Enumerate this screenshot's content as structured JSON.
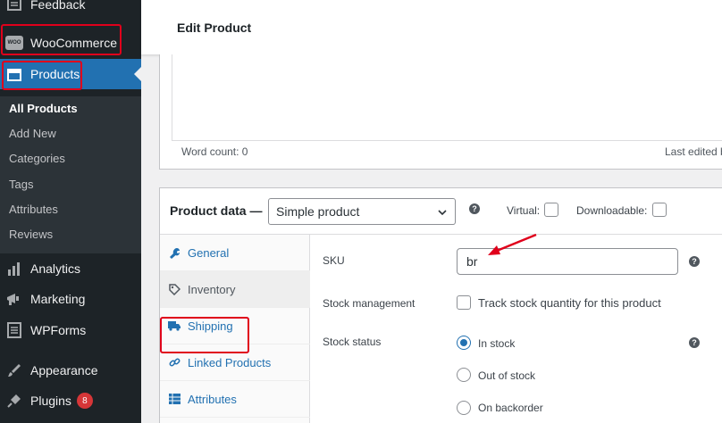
{
  "sidebar": {
    "items": [
      {
        "label": "Feedback",
        "icon": "feedback-icon"
      },
      {
        "label": "WooCommerce",
        "icon": "woocommerce-icon"
      },
      {
        "label": "Products",
        "icon": "products-icon"
      },
      {
        "label": "Analytics",
        "icon": "analytics-icon"
      },
      {
        "label": "Marketing",
        "icon": "marketing-icon"
      },
      {
        "label": "WPForms",
        "icon": "wpforms-icon"
      },
      {
        "label": "Appearance",
        "icon": "appearance-icon"
      },
      {
        "label": "Plugins",
        "icon": "plugins-icon",
        "badge": "8"
      }
    ],
    "submenu": [
      "All Products",
      "Add New",
      "Categories",
      "Tags",
      "Attributes",
      "Reviews"
    ],
    "woo_logo_text": "WOO"
  },
  "header": {
    "title": "Edit Product"
  },
  "editor": {
    "word_count": "Word count: 0",
    "last_edited": "Last edited b"
  },
  "product_data": {
    "title": "Product data —",
    "type_selected": "Simple product",
    "virtual_label": "Virtual:",
    "downloadable_label": "Downloadable:",
    "tabs": [
      {
        "label": "General",
        "icon": "wrench-icon"
      },
      {
        "label": "Inventory",
        "icon": "tag-icon"
      },
      {
        "label": "Shipping",
        "icon": "truck-icon"
      },
      {
        "label": "Linked Products",
        "icon": "link-icon"
      },
      {
        "label": "Attributes",
        "icon": "table-icon"
      }
    ],
    "sku_label": "SKU",
    "sku_value": "br",
    "stock_management_label": "Stock management",
    "track_label": "Track stock quantity for this product",
    "stock_status_label": "Stock status",
    "stock_options": [
      "In stock",
      "Out of stock",
      "On backorder"
    ],
    "help_glyph": "?"
  },
  "colors": {
    "accent": "#2271b1",
    "sidebar": "#1d2327",
    "highlight": "#e0001b",
    "badge": "#d63638"
  }
}
